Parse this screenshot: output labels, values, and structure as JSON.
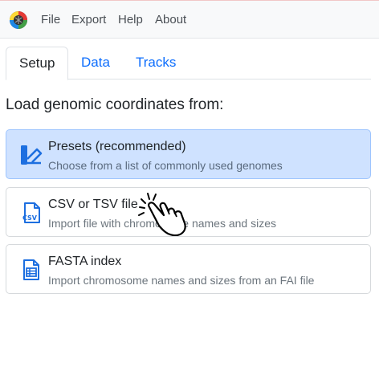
{
  "menu": {
    "items": [
      {
        "label": "File"
      },
      {
        "label": "Export"
      },
      {
        "label": "Help"
      },
      {
        "label": "About"
      }
    ]
  },
  "tabs": [
    {
      "label": "Setup",
      "active": true
    },
    {
      "label": "Data",
      "active": false
    },
    {
      "label": "Tracks",
      "active": false
    }
  ],
  "main": {
    "heading": "Load genomic coordinates from:",
    "options": [
      {
        "title": "Presets (recommended)",
        "subtitle": "Choose from a list of commonly used genomes",
        "icon": "presets-icon",
        "selected": true
      },
      {
        "title": "CSV or TSV file",
        "subtitle": "Import file with chromosome names and sizes",
        "icon": "csv-file-icon",
        "selected": false
      },
      {
        "title": "FASTA index",
        "subtitle": "Import chromosome names and sizes from an FAI file",
        "icon": "fasta-file-icon",
        "selected": false
      }
    ]
  },
  "colors": {
    "accent": "#0d6efd",
    "selected_bg": "#cfe2ff",
    "icon_blue": "#1d6fe0"
  }
}
